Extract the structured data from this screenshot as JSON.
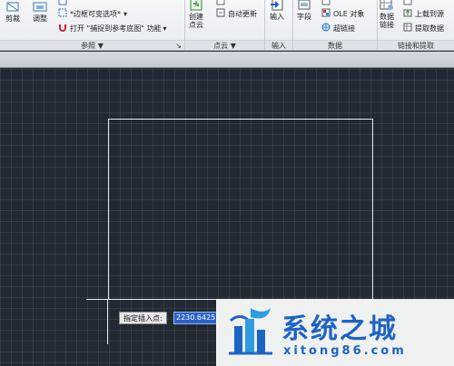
{
  "ribbon": {
    "reference_panel": {
      "title": "参照",
      "cut_label": "剪裁",
      "adjust_label": "调整",
      "frame_toggle_label": "*边框可变选项*",
      "snap_label": "打开 \"捕捉到参考底图\" 功能"
    },
    "pointcloud_panel": {
      "title": "点云",
      "create_label": "创建",
      "create_label2": "点云",
      "auto_update_label": "自动更新"
    },
    "import_panel": {
      "title": "输入",
      "import_label": "输入"
    },
    "data_panel": {
      "title": "数据",
      "field_label": "字段",
      "ole_label": "OLE 对象",
      "hyperlink_label": "超链接"
    },
    "link_panel": {
      "title": "链接和提取",
      "data_link_label": "数据",
      "data_link_label2": "链接",
      "upload_label": "上载到源",
      "extract_label": "提取数据"
    }
  },
  "canvas": {
    "prompt_label": "指定插入点:",
    "coordinate_value": "2230.6425"
  },
  "watermark": {
    "title": "系统之城",
    "url": "xitong86.com"
  },
  "colors": {
    "canvas_bg": "#222933",
    "geometry": "#e9ecf0",
    "input_highlight": "#2a62c8",
    "watermark_blue": "#1d63c4"
  }
}
